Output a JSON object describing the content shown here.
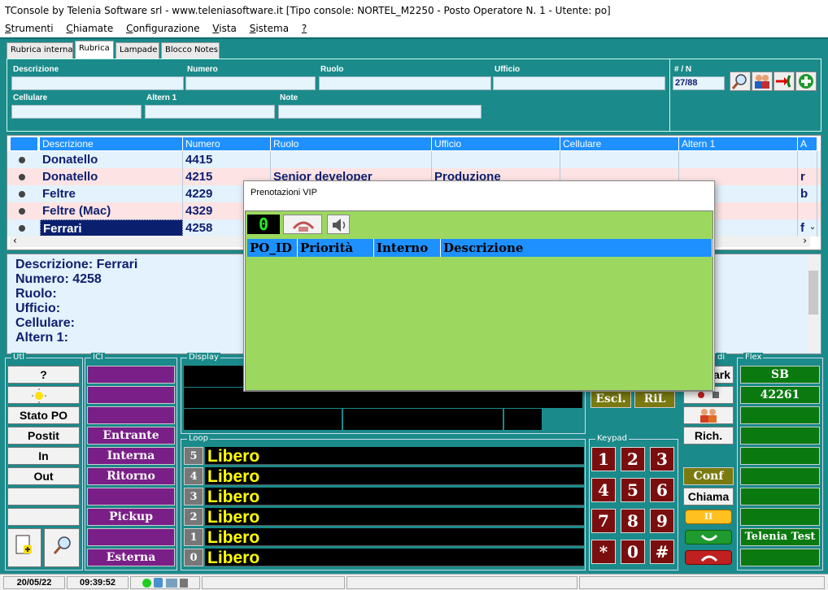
{
  "window": {
    "title": "TConsole by Telenia Software srl - www.teleniasoftware.it   [Tipo console: NORTEL_M2250 - Posto Operatore N. 1 - Utente: po]"
  },
  "menu": [
    {
      "key": "S",
      "rest": "trumenti"
    },
    {
      "key": "C",
      "rest": "hiamate"
    },
    {
      "key": "C",
      "rest": "onfigurazione"
    },
    {
      "key": "V",
      "rest": "ista"
    },
    {
      "key": "S",
      "rest": "istema"
    },
    {
      "key": "?",
      "rest": ""
    }
  ],
  "tabs": [
    "Rubrica interna",
    "Rubrica",
    "Lampade",
    "Blocco Notes"
  ],
  "search": {
    "labels": [
      "Descrizione",
      "Numero",
      "Ruolo",
      "Ufficio",
      "Cellulare",
      "Altern 1",
      "Note"
    ],
    "count_label": "# / N",
    "count_value": "27/88"
  },
  "table": {
    "headers": [
      "Descrizione",
      "Numero",
      "Ruolo",
      "Ufficio",
      "Cellulare",
      "Altern 1",
      "A"
    ],
    "rows": [
      {
        "descr": "Donatello",
        "num": "4415",
        "ruolo": "",
        "ufficio": "",
        "extra": ""
      },
      {
        "descr": "Donatello",
        "num": "4215",
        "ruolo": "Senior developer",
        "ufficio": "Produzione",
        "extra": "r"
      },
      {
        "descr": "Feltre",
        "num": "4229",
        "ruolo": "",
        "ufficio": "",
        "extra": "b"
      },
      {
        "descr": "Feltre (Mac)",
        "num": "4329",
        "ruolo": "",
        "ufficio": "",
        "extra": ""
      },
      {
        "descr": "Ferrari",
        "num": "4258",
        "ruolo": "",
        "ufficio": "",
        "extra": "f"
      }
    ]
  },
  "details": {
    "l1": "Descrizione: Ferrari",
    "l2": "Numero: 4258",
    "l3": "Ruolo:",
    "l4": "Ufficio:",
    "l5": "Cellulare:",
    "l6": "Altern 1:"
  },
  "groups": {
    "utl": "Utl",
    "ici": "ICI",
    "display": "Display",
    "loop": "Loop",
    "keypad": "Keypad",
    "flex": "Flex",
    "di": "di"
  },
  "utl_buttons": [
    "?",
    "Stato PO",
    "Postit",
    "In",
    "Out"
  ],
  "ici_buttons": [
    "Entrante",
    "Interna",
    "Ritorno",
    "Pickup",
    "Esterna"
  ],
  "loops": [
    {
      "n": "5",
      "s": "Libero"
    },
    {
      "n": "4",
      "s": "Libero"
    },
    {
      "n": "3",
      "s": "Libero"
    },
    {
      "n": "2",
      "s": "Libero"
    },
    {
      "n": "1",
      "s": "Libero"
    },
    {
      "n": "0",
      "s": "Libero"
    }
  ],
  "keys": [
    "1",
    "2",
    "3",
    "4",
    "5",
    "6",
    "7",
    "8",
    "9",
    "*",
    "0",
    "#"
  ],
  "center": {
    "escl": "Escl.",
    "ril": "RiL"
  },
  "right_col": {
    "park": "ark",
    "rich": "Rich.",
    "conf": "Conf",
    "chiama": "Chiama",
    "hold": "II"
  },
  "flex": [
    "SB",
    "42261",
    "Telenia Test"
  ],
  "status": {
    "date": "20/05/22",
    "time": "09:39:52"
  },
  "modal": {
    "title": "Prenotazioni VIP",
    "counter": "0",
    "headers": [
      "PO_ID",
      "Priorità",
      "Interno",
      "Descrizione"
    ]
  }
}
